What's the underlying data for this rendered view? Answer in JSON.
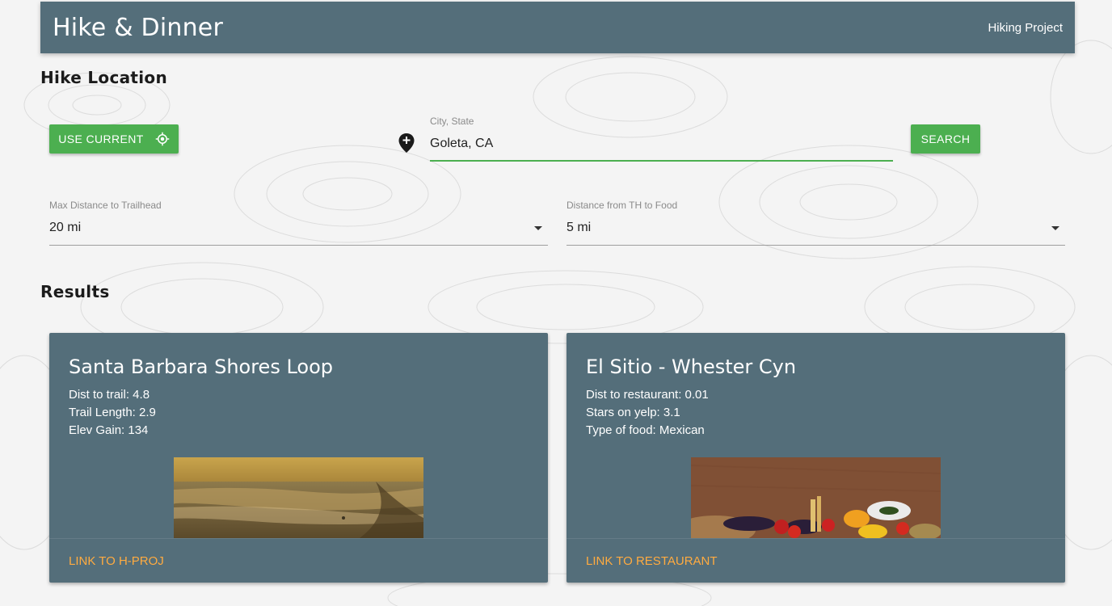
{
  "navbar": {
    "brand": "Hike & Dinner",
    "link": "Hiking Project"
  },
  "location_section": {
    "title": "Hike Location",
    "use_current_label": "USE CURRENT",
    "city_field": {
      "label": "City, State",
      "value": "Goleta, CA"
    },
    "search_label": "SEARCH"
  },
  "filters": {
    "max_distance": {
      "label": "Max Distance to Trailhead",
      "value": "20 mi"
    },
    "food_distance": {
      "label": "Distance from TH to Food",
      "value": "5 mi"
    }
  },
  "results": {
    "title": "Results",
    "trail_card": {
      "title": "Santa Barbara Shores Loop",
      "lines": [
        "Dist to trail: 4.8",
        "Trail Length: 2.9",
        "Elev Gain: 134"
      ],
      "link": "LINK TO H-PROJ"
    },
    "restaurant_card": {
      "title": "El Sitio - Whester Cyn",
      "lines": [
        "Dist to restaurant: 0.01",
        "Stars on yelp: 3.1",
        "Type of food: Mexican"
      ],
      "link": "LINK TO RESTAURANT"
    }
  },
  "colors": {
    "primary": "#546e7a",
    "accent_green": "#4caf50",
    "link_orange": "#ffab40"
  }
}
